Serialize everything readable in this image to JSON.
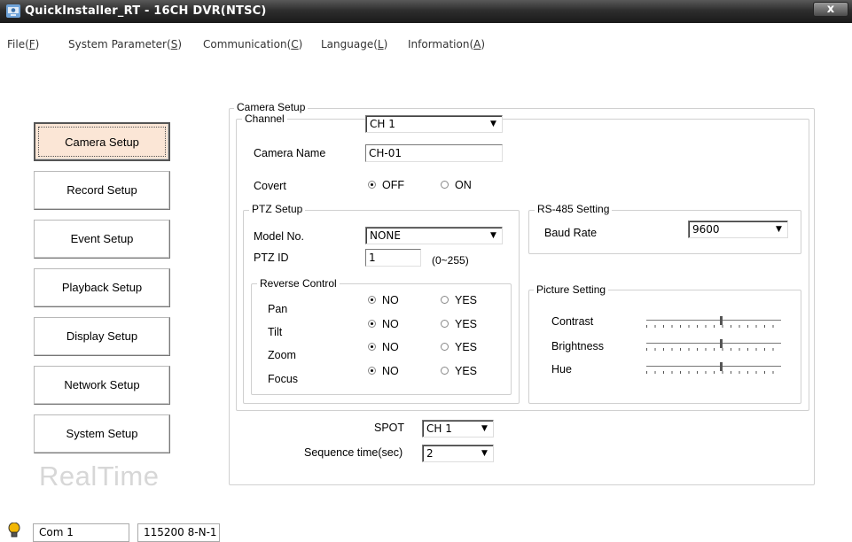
{
  "window": {
    "title": "QuickInstaller_RT - 16CH DVR(NTSC)",
    "close_label": "x"
  },
  "menu": [
    {
      "label": "File(",
      "key": "F",
      "end": ")"
    },
    {
      "label": "System Parameter(",
      "key": "S",
      "end": ")"
    },
    {
      "label": "Communication(",
      "key": "C",
      "end": ")"
    },
    {
      "label": "Language(",
      "key": "L",
      "end": ")"
    },
    {
      "label": "Information(",
      "key": "A",
      "end": ")"
    }
  ],
  "nav": [
    {
      "label": "Camera Setup",
      "active": true
    },
    {
      "label": "Record Setup"
    },
    {
      "label": "Event Setup"
    },
    {
      "label": "Playback Setup"
    },
    {
      "label": "Display Setup"
    },
    {
      "label": "Network Setup"
    },
    {
      "label": "System Setup"
    }
  ],
  "watermark": "RealTime",
  "camera_setup": {
    "group_title": "Camera Setup",
    "channel_label": "Channel",
    "channel_value": "CH  1",
    "camera_name_label": "Camera Name",
    "camera_name_value": "CH-01",
    "covert_label": "Covert",
    "covert_off": "OFF",
    "covert_on": "ON",
    "covert_selected": "OFF",
    "ptz": {
      "group_title": "PTZ Setup",
      "model_label": "Model No.",
      "model_value": "NONE",
      "id_label": "PTZ ID",
      "id_value": "1",
      "id_range": "(0~255)",
      "reverse": {
        "group_title": "Reverse Control",
        "rows": [
          {
            "label": "Pan",
            "no": "NO",
            "yes": "YES",
            "selected": "NO"
          },
          {
            "label": "Tilt",
            "no": "NO",
            "yes": "YES",
            "selected": "NO"
          },
          {
            "label": "Zoom",
            "no": "NO",
            "yes": "YES",
            "selected": "NO"
          },
          {
            "label": "Focus",
            "no": "NO",
            "yes": "YES",
            "selected": "NO"
          }
        ]
      }
    },
    "rs485": {
      "group_title": "RS-485 Setting",
      "baud_label": "Baud Rate",
      "baud_value": "9600"
    },
    "picture": {
      "group_title": "Picture Setting",
      "contrast_label": "Contrast",
      "brightness_label": "Brightness",
      "hue_label": "Hue",
      "contrast_level": 0.55,
      "brightness_level": 0.55,
      "hue_level": 0.55
    },
    "spot_label": "SPOT",
    "spot_value": "CH  1",
    "sequence_label": "Sequence time(sec)",
    "sequence_value": "2"
  },
  "status": {
    "port": "Com 1",
    "settings": "115200 8-N-1"
  },
  "colors": {
    "titlebar": "#2e2e2e",
    "active_button": "#fbe6d6"
  }
}
